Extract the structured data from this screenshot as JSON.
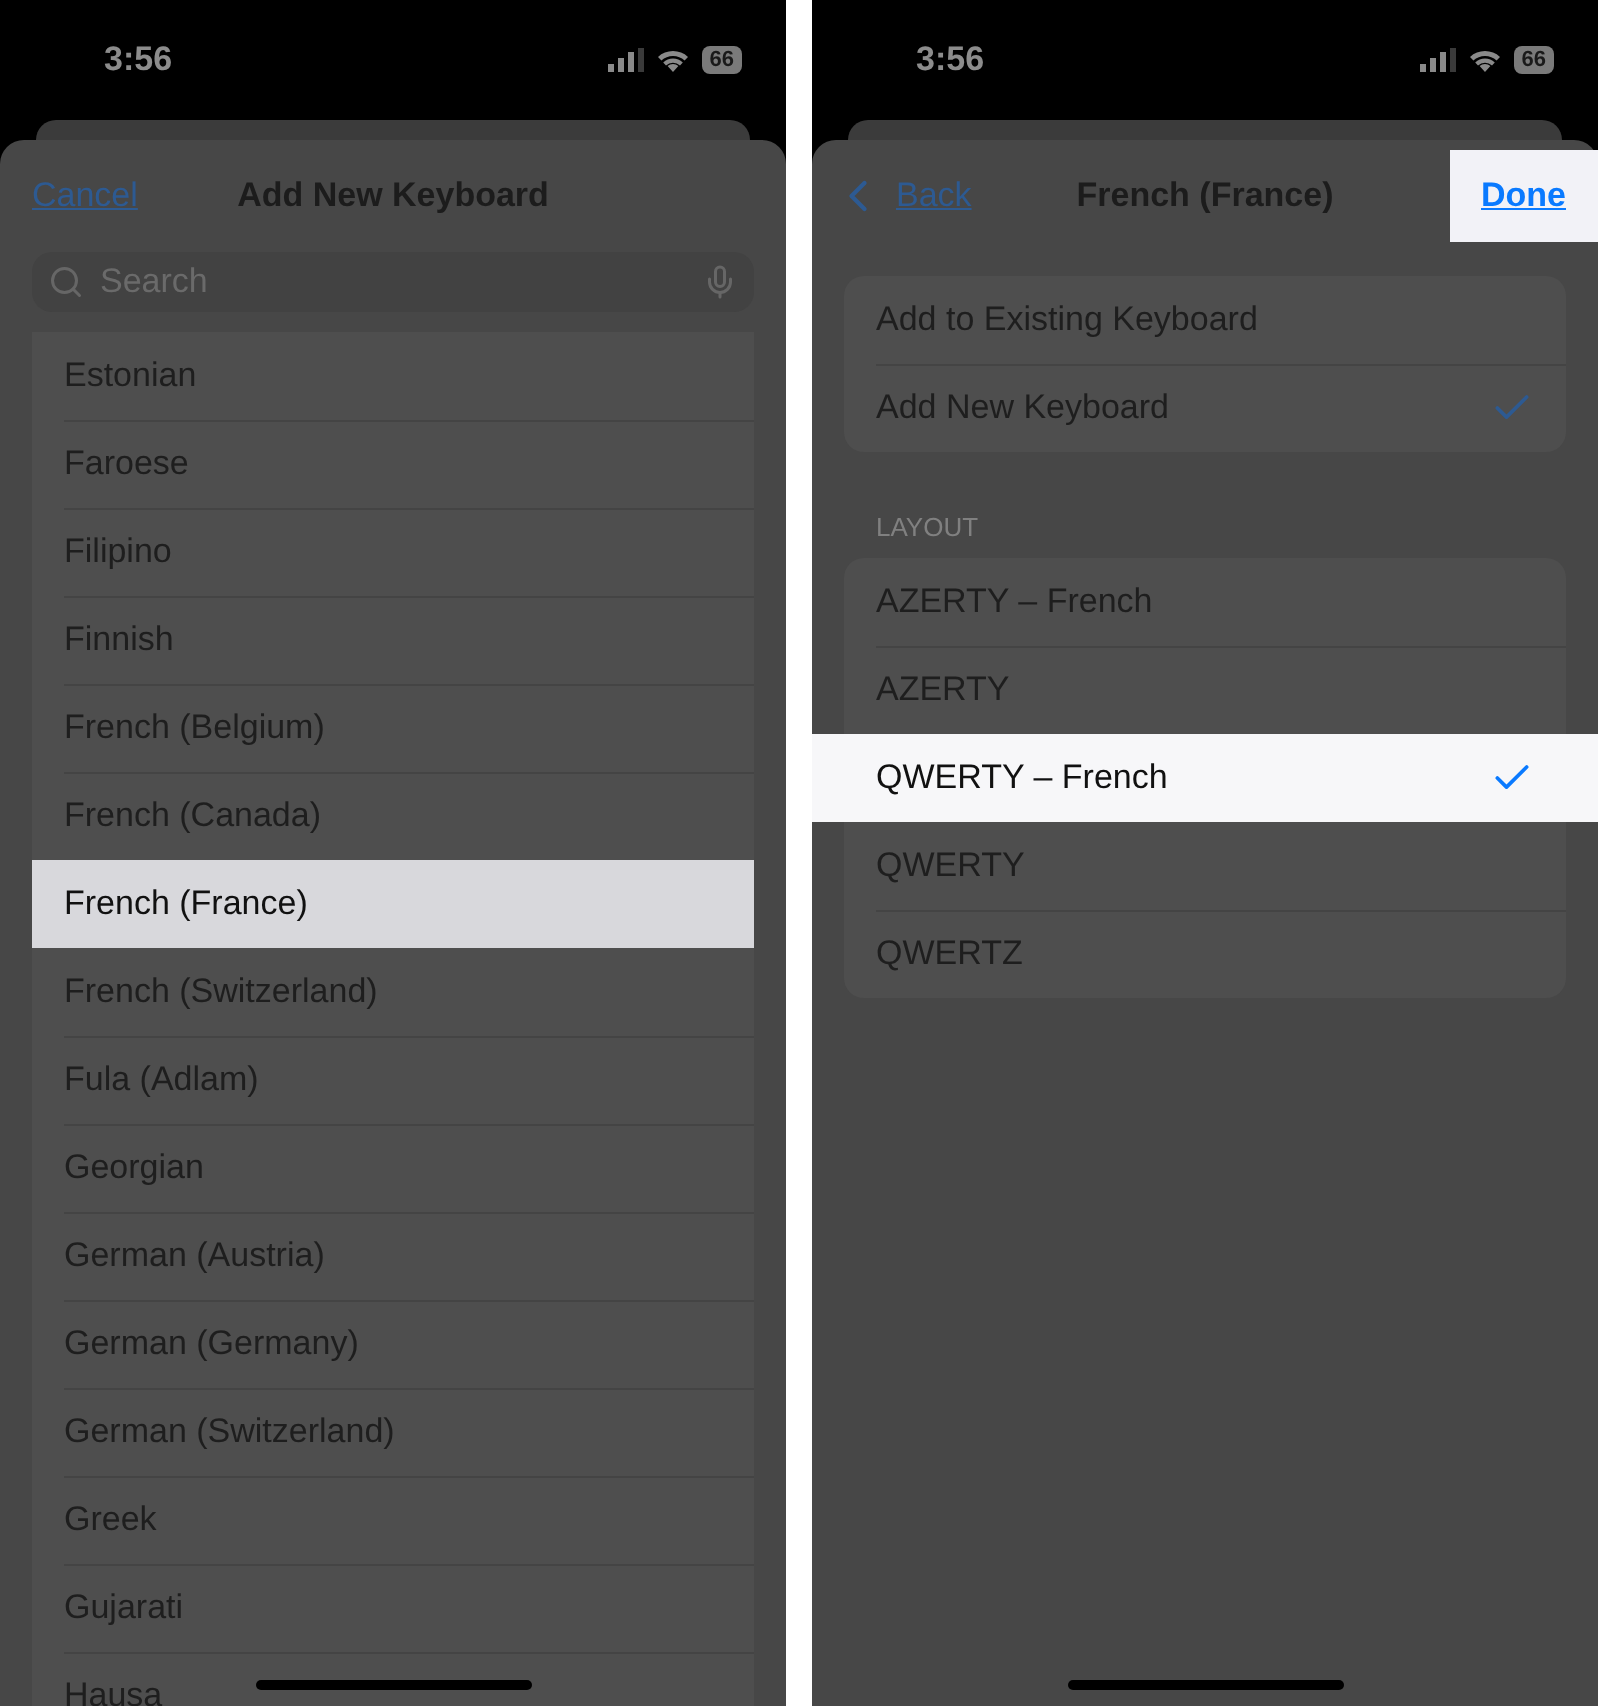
{
  "left_screen": {
    "status": {
      "time": "3:56",
      "battery": "66"
    },
    "nav": {
      "cancel": "Cancel",
      "title": "Add New Keyboard"
    },
    "search": {
      "placeholder": "Search"
    },
    "languages": [
      {
        "label": "Estonian",
        "selected": false
      },
      {
        "label": "Faroese",
        "selected": false
      },
      {
        "label": "Filipino",
        "selected": false
      },
      {
        "label": "Finnish",
        "selected": false
      },
      {
        "label": "French (Belgium)",
        "selected": false
      },
      {
        "label": "French (Canada)",
        "selected": false
      },
      {
        "label": "French (France)",
        "selected": true
      },
      {
        "label": "French (Switzerland)",
        "selected": false
      },
      {
        "label": "Fula (Adlam)",
        "selected": false
      },
      {
        "label": "Georgian",
        "selected": false
      },
      {
        "label": "German (Austria)",
        "selected": false
      },
      {
        "label": "German (Germany)",
        "selected": false
      },
      {
        "label": "German (Switzerland)",
        "selected": false
      },
      {
        "label": "Greek",
        "selected": false
      },
      {
        "label": "Gujarati",
        "selected": false
      },
      {
        "label": "Hausa",
        "selected": false
      }
    ]
  },
  "right_screen": {
    "status": {
      "time": "3:56",
      "battery": "66"
    },
    "nav": {
      "back": "Back",
      "title": "French (France)",
      "done": "Done",
      "done_highlighted": true
    },
    "modes": [
      {
        "label": "Add to Existing Keyboard",
        "checked": false,
        "selected": false
      },
      {
        "label": "Add New Keyboard",
        "checked": true,
        "selected": false
      }
    ],
    "layout_header": "LAYOUT",
    "layouts": [
      {
        "label": "AZERTY – French",
        "checked": false,
        "selected": false
      },
      {
        "label": "AZERTY",
        "checked": false,
        "selected": false
      },
      {
        "label": "QWERTY – French",
        "checked": true,
        "selected": true
      },
      {
        "label": "QWERTY",
        "checked": false,
        "selected": false
      },
      {
        "label": "QWERTZ",
        "checked": false,
        "selected": false
      }
    ]
  }
}
